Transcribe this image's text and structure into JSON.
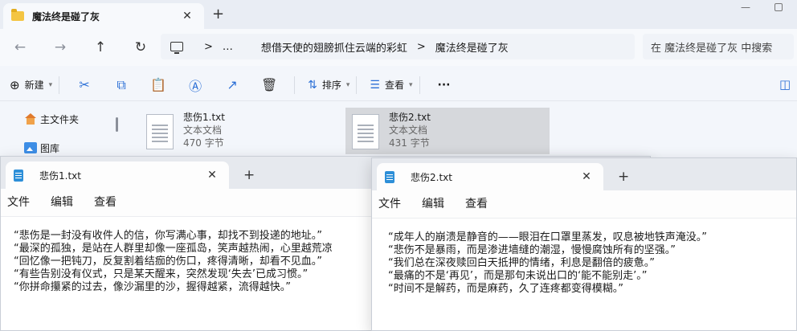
{
  "explorer": {
    "tab_title": "魔法终是碰了灰",
    "tab_close": "✕",
    "new_tab": "+",
    "min_glyph": "—",
    "nav": {
      "back": "←",
      "forward": "→",
      "up": "↑",
      "refresh": "↻"
    },
    "breadcrumb": {
      "ellipsis": "…",
      "sep": ">",
      "parent": "想借天使的翅膀抓住云端的彩虹",
      "current": "魔法终是碰了灰"
    },
    "search_placeholder": "在 魔法终是碰了灰 中搜索",
    "toolbar": {
      "new_label": "新建",
      "sort_label": "排序",
      "view_label": "查看",
      "more": "···",
      "icons": {
        "new": "⊕",
        "cut": "✂",
        "copy": "⧉",
        "paste": "📋",
        "rename": "Ⓐ",
        "share": "↗",
        "delete": "🗑",
        "sort": "⇅",
        "view": "☰",
        "details": "◫"
      }
    },
    "sidebar": {
      "items": [
        {
          "label": "主文件夹"
        },
        {
          "label": "图库"
        }
      ]
    },
    "files": [
      {
        "name": "悲伤1.txt",
        "type": "文本文档",
        "size": "470 字节"
      },
      {
        "name": "悲伤2.txt",
        "type": "文本文档",
        "size": "431 字节"
      }
    ]
  },
  "notepad1": {
    "tab_title": "悲伤1.txt",
    "close": "✕",
    "new_tab": "+",
    "menu": [
      "文件",
      "编辑",
      "查看"
    ],
    "lines": [
      "“悲伤是一封没有收件人的信，你写满心事，却找不到投递的地址。”",
      "“最深的孤独，是站在人群里却像一座孤岛，笑声越热闹，心里越荒凉",
      "“回忆像一把钝刀，反复割着结痂的伤口，疼得清晰，却看不见血。”",
      "“有些告别没有仪式，只是某天醒来，突然发现‘失去’已成习惯。”",
      "“你拼命攥紧的过去，像沙漏里的沙，握得越紧，流得越快。”"
    ]
  },
  "notepad2": {
    "tab_title": "悲伤2.txt",
    "close": "✕",
    "new_tab": "+",
    "menu": [
      "文件",
      "编辑",
      "查看"
    ],
    "lines": [
      "“成年人的崩溃是静音的——眼泪在口罩里蒸发，叹息被地铁声淹没。”",
      "“悲伤不是暴雨，而是渗进墙缝的潮湿，慢慢腐蚀所有的坚强。”",
      "“我们总在深夜赎回白天抵押的情绪，利息是翻倍的疲惫。”",
      "“最痛的不是‘再见’，而是那句未说出口的‘能不能别走’。”",
      "“时间不是解药，而是麻药，久了连疼都变得模糊。”"
    ]
  }
}
